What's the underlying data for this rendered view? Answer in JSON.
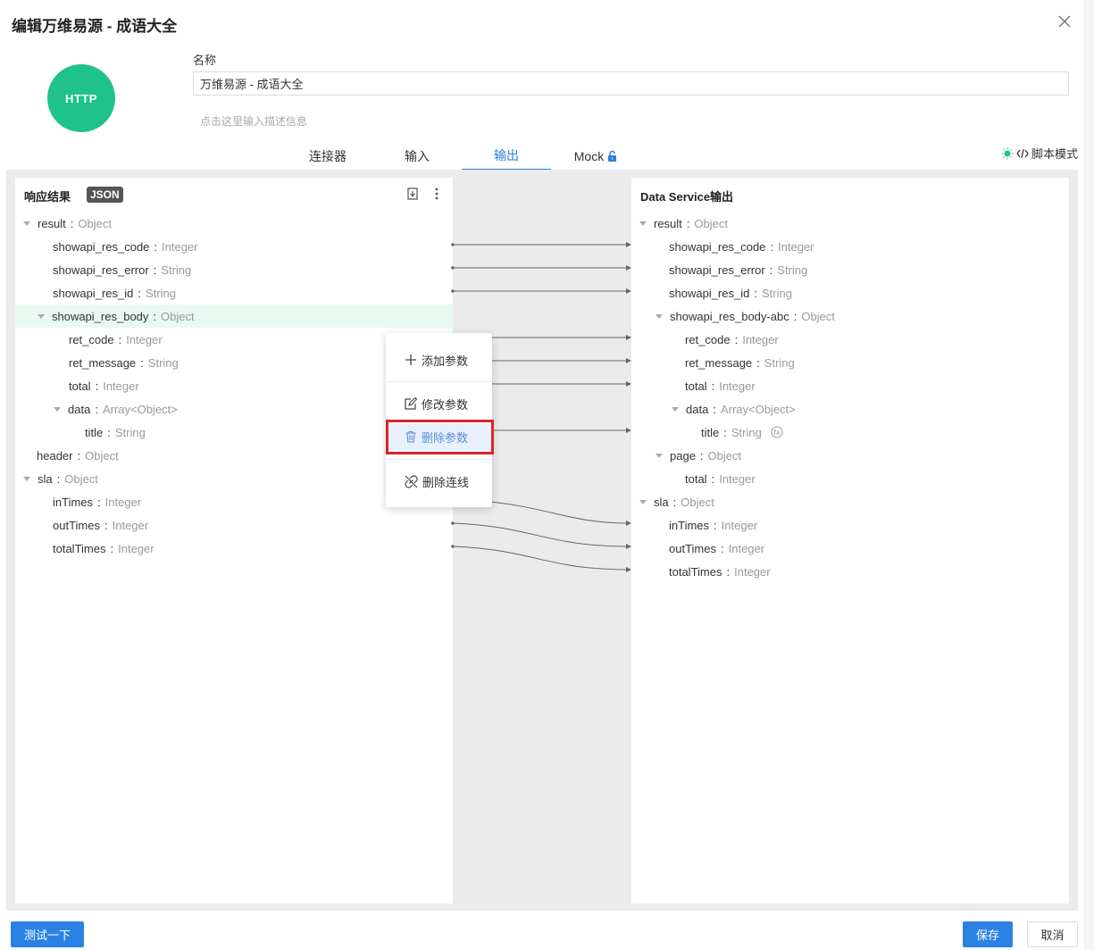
{
  "dialog": {
    "title": "编辑万维易源 - 成语大全"
  },
  "logo": {
    "text": "HTTP",
    "color": "#1fc28b"
  },
  "form": {
    "name_label": "名称",
    "name_value": "万维易源 - 成语大全",
    "description_placeholder": "点击这里输入描述信息"
  },
  "tabs": [
    {
      "label": "连接器",
      "active": false
    },
    {
      "label": "输入",
      "active": false
    },
    {
      "label": "输出",
      "active": true
    },
    {
      "label": "Mock",
      "active": false,
      "icon": "lock-icon"
    }
  ],
  "script_mode": {
    "label": "脚本模式",
    "icon": "code-icon"
  },
  "left_panel": {
    "title": "响应结果",
    "badge": "JSON",
    "tree": [
      {
        "key": "result",
        "type": "Object",
        "collapsible": true
      },
      {
        "key": "showapi_res_code",
        "type": "Integer"
      },
      {
        "key": "showapi_res_error",
        "type": "String"
      },
      {
        "key": "showapi_res_id",
        "type": "String"
      },
      {
        "key": "showapi_res_body",
        "type": "Object",
        "collapsible": true,
        "highlighted": true
      },
      {
        "key": "ret_code",
        "type": "Integer"
      },
      {
        "key": "ret_message",
        "type": "String"
      },
      {
        "key": "total",
        "type": "Integer"
      },
      {
        "key": "data",
        "type": "Array<Object>",
        "collapsible": true
      },
      {
        "key": "title",
        "type": "String"
      },
      {
        "key": "header",
        "type": "Object"
      },
      {
        "key": "sla",
        "type": "Object",
        "collapsible": true
      },
      {
        "key": "inTimes",
        "type": "Integer"
      },
      {
        "key": "outTimes",
        "type": "Integer"
      },
      {
        "key": "totalTimes",
        "type": "Integer"
      }
    ]
  },
  "right_panel": {
    "title": "Data Service输出",
    "tree": [
      {
        "key": "result",
        "type": "Object",
        "collapsible": true
      },
      {
        "key": "showapi_res_code",
        "type": "Integer"
      },
      {
        "key": "showapi_res_error",
        "type": "String"
      },
      {
        "key": "showapi_res_id",
        "type": "String"
      },
      {
        "key": "showapi_res_body-abc",
        "type": "Object",
        "collapsible": true
      },
      {
        "key": "ret_code",
        "type": "Integer"
      },
      {
        "key": "ret_message",
        "type": "String"
      },
      {
        "key": "total",
        "type": "Integer"
      },
      {
        "key": "data",
        "type": "Array<Object>",
        "collapsible": true
      },
      {
        "key": "title",
        "type": "String",
        "icon": "function-icon"
      },
      {
        "key": "page",
        "type": "Object",
        "collapsible": true
      },
      {
        "key": "total",
        "type": "Integer"
      },
      {
        "key": "sla",
        "type": "Object",
        "collapsible": true
      },
      {
        "key": "inTimes",
        "type": "Integer"
      },
      {
        "key": "outTimes",
        "type": "Integer"
      },
      {
        "key": "totalTimes",
        "type": "Integer"
      }
    ]
  },
  "context_menu": {
    "items": [
      {
        "label": "添加参数",
        "icon": "plus-icon"
      },
      {
        "label": "修改参数",
        "icon": "edit-icon"
      },
      {
        "label": "删除参数",
        "icon": "trash-icon",
        "hovered": true
      },
      {
        "label": "删除连线",
        "icon": "unlink-icon"
      }
    ]
  },
  "footer": {
    "test_label": "测试一下",
    "save_label": "保存",
    "cancel_label": "取消"
  },
  "colors": {
    "primary": "#2a82e4",
    "active_tab": "#2a7fd4",
    "highlight_row": "#e9f9f2",
    "focus_border": "#d8262b"
  }
}
